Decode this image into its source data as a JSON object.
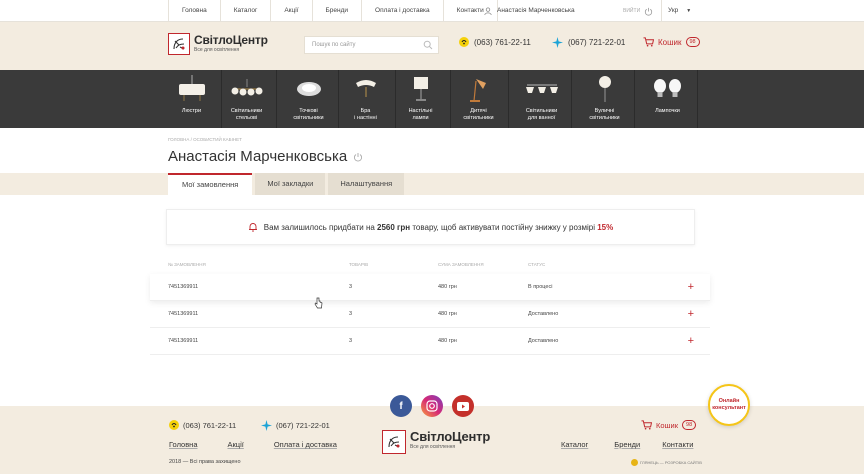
{
  "topbar": {
    "nav": [
      "Головна",
      "Каталог",
      "Акції",
      "Бренди",
      "Оплата і доставка",
      "Контакти"
    ],
    "user_name": "Анастасія Марченковська",
    "logout_label": "ВИЙТИ",
    "lang": "Укр"
  },
  "header": {
    "logo_title": "СвітлоЦентр",
    "logo_sub": "Все для освітлення",
    "search_placeholder": "Пошук по сайту",
    "phone1": "(063) 761-22-11",
    "phone2": "(067) 721-22-01",
    "cart_label": "Кошик",
    "cart_count": "98"
  },
  "categories": [
    {
      "label": "Люстри"
    },
    {
      "label": "Світильники\nстельові"
    },
    {
      "label": "Точкові\nсвітильники"
    },
    {
      "label": "Бра\nі настінні"
    },
    {
      "label": "Настільні\nлампи"
    },
    {
      "label": "Дитячі\nсвітильники"
    },
    {
      "label": "Світильники\nдля ванної"
    },
    {
      "label": "Вуличні\nсвітильники"
    },
    {
      "label": "Лампочки"
    }
  ],
  "page": {
    "breadcrumb": "ГОЛОВНА / ОСОБИСТИЙ КАБІНЕТ",
    "title": "Анастасія Марченковська",
    "tabs": [
      "Мої замовлення",
      "Мої закладки",
      "Налаштування"
    ],
    "notice_pre": "Вам залишилось придбати на ",
    "notice_amount": "2560 грн",
    "notice_mid": " товару, щоб активувати постійну знижку у розмірі ",
    "notice_pct": "15%"
  },
  "orders": {
    "headers": [
      "№ замовлення",
      "Товарів",
      "Сума замовлення",
      "Статус"
    ],
    "rows": [
      {
        "id": "7451369911",
        "items": "3",
        "sum": "480 грн",
        "status": "В процесі"
      },
      {
        "id": "7451369911",
        "items": "3",
        "sum": "480 грн",
        "status": "Доставлено"
      },
      {
        "id": "7451369911",
        "items": "3",
        "sum": "480 грн",
        "status": "Доставлено"
      }
    ]
  },
  "footer": {
    "phone1": "(063) 761-22-11",
    "phone2": "(067) 721-22-01",
    "cart_label": "Кошик",
    "cart_count": "98",
    "links_left": [
      "Головна",
      "Акції",
      "Оплата і доставка"
    ],
    "links_right": [
      "Каталог",
      "Бренди",
      "Контакти"
    ],
    "logo_title": "СвітлоЦентр",
    "logo_sub": "Все для освітлення",
    "copyright": "2018 — Всі права захищено",
    "developer": "ГЛЯНЕЦЬ — РОЗРОБКА САЙТІВ",
    "chat_label": "Онлайн\nконсультант"
  },
  "colors": {
    "accent": "#c0272d",
    "beige": "#f3ece0",
    "dark": "#3a3a3a"
  }
}
